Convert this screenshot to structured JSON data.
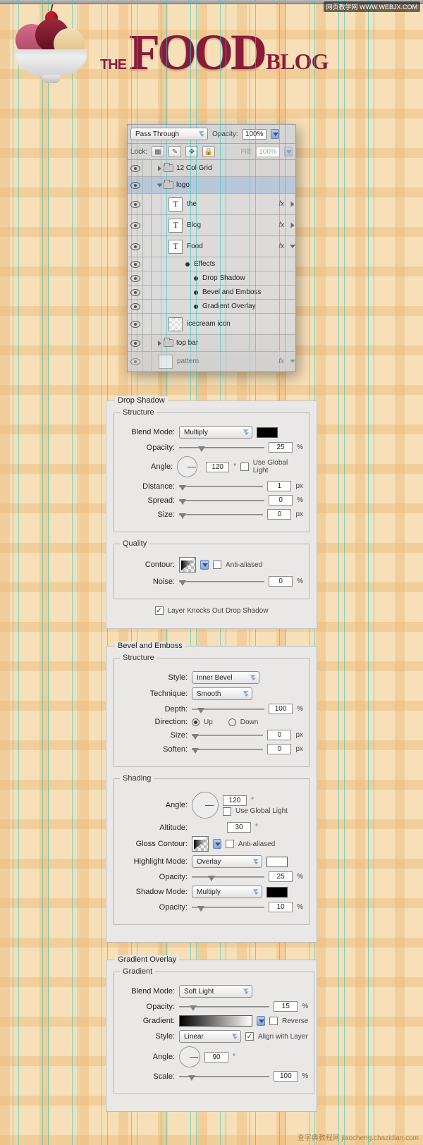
{
  "watermark_top": "网页教学网\nWWW.WEBJX.COM",
  "watermark_bottom": "查字典教程网 jiaocheng.chazidian.com",
  "logo": {
    "the": "THE",
    "food": "FOOD",
    "blog": "BLOG"
  },
  "layers_panel": {
    "blend": "Pass Through",
    "opacity_label": "Opacity:",
    "opacity_value": "100%",
    "lock_label": "Lock:",
    "fill_label": "Fill:",
    "fill_value": "100%",
    "rows": [
      {
        "name": "12 Col Grid"
      },
      {
        "name": "logo"
      },
      {
        "name": "the"
      },
      {
        "name": "Blog"
      },
      {
        "name": "Food"
      },
      {
        "name": "Effects"
      },
      {
        "name": "Drop Shadow"
      },
      {
        "name": "Bevel and Emboss"
      },
      {
        "name": "Gradient Overlay"
      },
      {
        "name": "icecream icon"
      },
      {
        "name": "top bar"
      },
      {
        "name": "pattern"
      }
    ],
    "fx_label": "fx"
  },
  "drop_shadow": {
    "title": "Drop Shadow",
    "structure": "Structure",
    "blend_mode_label": "Blend Mode:",
    "blend_mode": "Multiply",
    "opacity_label": "Opacity:",
    "opacity": "25",
    "angle_label": "Angle:",
    "angle": "120",
    "global_light": "Use Global Light",
    "distance_label": "Distance:",
    "distance": "1",
    "spread_label": "Spread:",
    "spread": "0",
    "size_label": "Size:",
    "size": "0",
    "quality": "Quality",
    "contour_label": "Contour:",
    "anti": "Anti-aliased",
    "noise_label": "Noise:",
    "noise": "0",
    "knock": "Layer Knocks Out Drop Shadow"
  },
  "bevel": {
    "title": "Bevel and Emboss",
    "structure": "Structure",
    "style_label": "Style:",
    "style": "Inner Bevel",
    "technique_label": "Technique:",
    "technique": "Smooth",
    "depth_label": "Depth:",
    "depth": "100",
    "direction_label": "Direction:",
    "up": "Up",
    "down": "Down",
    "size_label": "Size:",
    "size": "0",
    "soften_label": "Soften:",
    "soften": "0",
    "shading": "Shading",
    "angle_label": "Angle:",
    "angle": "120",
    "global_light": "Use Global Light",
    "altitude_label": "Altitude:",
    "altitude": "30",
    "gloss_label": "Gloss Contour:",
    "anti": "Anti-aliased",
    "hmode_label": "Highlight Mode:",
    "hmode": "Overlay",
    "hopacity_label": "Opacity:",
    "hopacity": "25",
    "smode_label": "Shadow Mode:",
    "smode": "Multiply",
    "sopacity_label": "Opacity:",
    "sopacity": "10"
  },
  "gradient": {
    "title": "Gradient Overlay",
    "gradient": "Gradient",
    "blend_label": "Blend Mode:",
    "blend": "Soft Light",
    "opacity_label": "Opacity:",
    "opacity": "15",
    "grad_label": "Gradient:",
    "reverse": "Reverse",
    "style_label": "Style:",
    "style": "Linear",
    "align": "Align with Layer",
    "angle_label": "Angle:",
    "angle": "90",
    "scale_label": "Scale:",
    "scale": "100"
  }
}
